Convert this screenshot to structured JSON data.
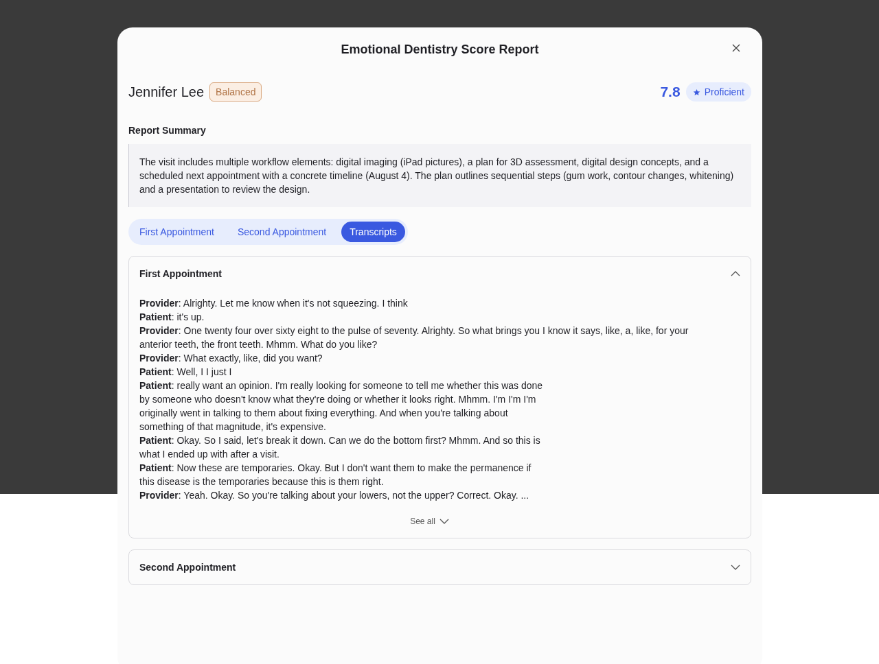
{
  "dialog": {
    "title": "Emotional Dentistry Score Report"
  },
  "patient": {
    "name": "Jennifer Lee",
    "tag": "Balanced",
    "score": "7.8",
    "level_badge": "Proficient"
  },
  "summary": {
    "heading": "Report Summary",
    "text": "The visit includes multiple workflow elements: digital imaging (iPad pictures), a plan for 3D assessment, digital design concepts, and a scheduled next appointment with a concrete timeline (August 4). The plan outlines sequential steps (gum work, contour changes, whitening) and a presentation to review the design."
  },
  "tabs": [
    {
      "label": "First Appointment",
      "selected": false
    },
    {
      "label": "Second Appointment",
      "selected": false
    },
    {
      "label": "Transcripts",
      "selected": true
    }
  ],
  "sections": [
    {
      "title": "First Appointment",
      "expanded": true,
      "see_all": "See all",
      "entries": [
        {
          "lines": [
            "**Provider**: Alrighty. Let me know when it's not squeezing. I think"
          ]
        },
        {
          "lines": [
            "**Patient**: it's up."
          ]
        },
        {
          "lines": [
            "**Provider**: One twenty four over sixty eight to the pulse of seventy. Alrighty. So what brings you I know it says, like, a, like, for your anterior teeth, the front teeth. Mhmm. What do you like?"
          ]
        },
        {
          "lines": [
            "**Provider**: What exactly, like, did you want?"
          ]
        },
        {
          "lines": [
            "**Patient**: Well, I I just I"
          ]
        },
        {
          "lines": [
            "**Patient**: really want an opinion. I'm really looking for someone to tell me whether this was done",
            "by someone who doesn't know what they're doing or whether it looks right. Mhmm. I'm I'm I'm",
            "originally went in talking to them about fixing everything. And when you're talking about",
            "something of that magnitude, it's expensive."
          ]
        },
        {
          "lines": [
            "**Patient**: Okay. So I said, let's break it down. Can we do the bottom first? Mhmm. And so this is",
            "what I ended up with after a visit."
          ]
        },
        {
          "lines": [
            "**Patient**: Now these are temporaries. Okay. But I don't want them to make the permanence if",
            "this disease is the temporaries because this is them right."
          ]
        },
        {
          "lines": [
            "**Provider**: Yeah. Okay. So you're talking about your lowers, not the upper? Correct. Okay.  ..."
          ]
        }
      ]
    },
    {
      "title": "Second Appointment",
      "expanded": false
    }
  ]
}
